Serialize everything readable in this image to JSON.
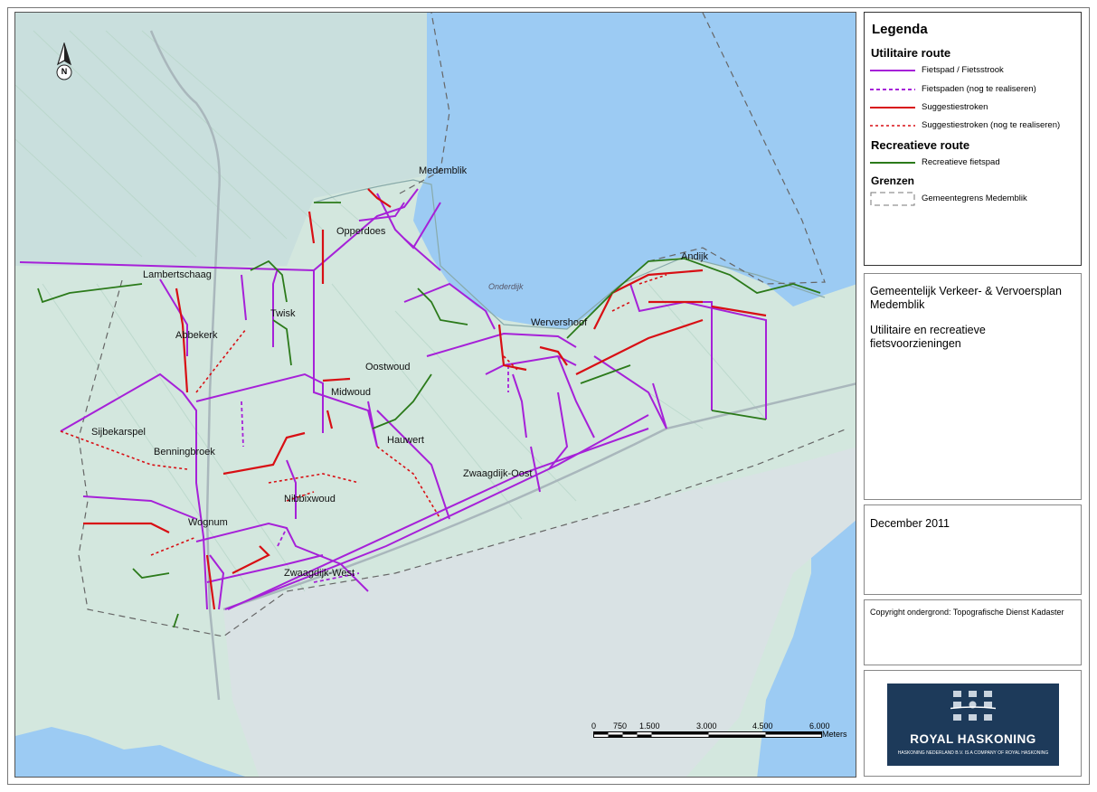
{
  "map": {
    "places": [
      {
        "name": "Medemblik"
      },
      {
        "name": "Opperdoes"
      },
      {
        "name": "Lambertschaag"
      },
      {
        "name": "Twisk"
      },
      {
        "name": "Abbekerk"
      },
      {
        "name": "Oostwoud"
      },
      {
        "name": "Midwoud"
      },
      {
        "name": "Hauwert"
      },
      {
        "name": "Sijbekarspel"
      },
      {
        "name": "Benningbroek"
      },
      {
        "name": "Nibbixwoud"
      },
      {
        "name": "Wognum"
      },
      {
        "name": "Zwaagdijk-West"
      },
      {
        "name": "Zwaagdijk-Oost"
      },
      {
        "name": "Wervershoof"
      },
      {
        "name": "Andijk"
      },
      {
        "name": "Onderdijk"
      }
    ],
    "north_label": "N",
    "scale": {
      "ticks": [
        "0",
        "750",
        "1.500",
        "3.000",
        "4.500",
        "6.000"
      ],
      "unit": "Meters"
    },
    "colors": {
      "water": "#9ccbf3",
      "land": "#cfe6dc",
      "fietspad": "#a621d8",
      "suggestiestrook": "#d80f14",
      "recreatief": "#2b7a1a",
      "grens": "#555555"
    }
  },
  "legend": {
    "title": "Legenda",
    "sections": [
      {
        "heading": "Utilitaire route",
        "items": [
          {
            "label": "Fietspad / Fietsstrook",
            "style": "purple-solid"
          },
          {
            "label": "Fietspaden (nog te realiseren)",
            "style": "purple-dashed"
          },
          {
            "label": "Suggestiestroken",
            "style": "red-solid"
          },
          {
            "label": "Suggestiestroken (nog te realiseren)",
            "style": "red-dashed"
          }
        ]
      },
      {
        "heading": "Recreatieve route",
        "items": [
          {
            "label": "Recreatieve fietspad",
            "style": "green-solid"
          }
        ]
      },
      {
        "heading": "Grenzen",
        "items": [
          {
            "label": "Gemeentegrens Medemblik",
            "style": "grey-dashed-box"
          }
        ]
      }
    ]
  },
  "info": {
    "line1": "Gemeentelijk Verkeer- & Vervoersplan Medemblik",
    "line2": "Utilitaire en recreatieve fietsvoorzieningen"
  },
  "date": "December 2011",
  "copyright": "Copyright ondergrond: Topografische Dienst Kadaster",
  "logo": {
    "name": "ROYAL HASKONING",
    "sub": "HASKONING NEDERLAND B.V. IS A COMPANY OF ROYAL HASKONING"
  }
}
